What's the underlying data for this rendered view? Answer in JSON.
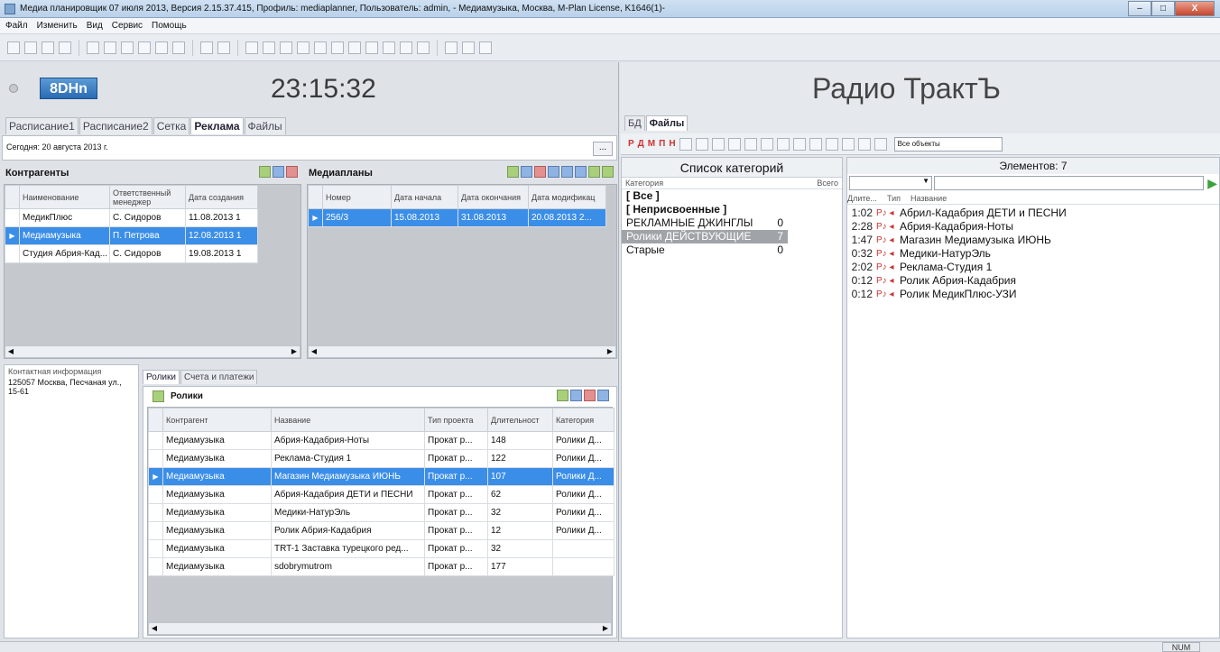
{
  "window": {
    "title": "Медиа планировщик 07 июля 2013, Версия 2.15.37.415, Профиль: mediaplanner, Пользователь: admin, - Медиамузыка, Москва, M-Plan License, K1646(1)-",
    "min": "–",
    "max": "□",
    "close": "X"
  },
  "menu": [
    "Файл",
    "Изменить",
    "Вид",
    "Сервис",
    "Помощь"
  ],
  "clock": "23:15:32",
  "logo": "8DHn",
  "radio_title": "Радио ТрактЪ",
  "left_tabs": [
    "Расписание1",
    "Расписание2",
    "Сетка",
    "Реклама",
    "Файлы"
  ],
  "today": "Сегодня: 20 августа 2013 г.",
  "dots_btn": "...",
  "contractors": {
    "title": "Контрагенты",
    "headers": [
      "Наименование",
      "Ответственный менеджер",
      "Дата создания"
    ],
    "rows": [
      [
        "МедикПлюс",
        "С. Сидоров",
        "11.08.2013 1"
      ],
      [
        "Медиамузыка",
        "П. Петрова",
        "12.08.2013 1"
      ],
      [
        "Студия Абрия-Кад...",
        "С. Сидоров",
        "19.08.2013 1"
      ]
    ]
  },
  "mediaplans": {
    "title": "Медиапланы",
    "headers": [
      "Номер",
      "Дата начала",
      "Дата окончания",
      "Дата модификац"
    ],
    "rows": [
      [
        "256/3",
        "15.08.2013",
        "31.08.2013",
        "20.08.2013 2..."
      ]
    ]
  },
  "contact": {
    "title": "Контактная информация",
    "text": "125057 Москва, Песчаная ул., 15-61"
  },
  "bottom_tabs": [
    "Ролики",
    "Счета и платежи"
  ],
  "clips": {
    "title": "Ролики",
    "headers": [
      "Контрагент",
      "Название",
      "Тип проекта",
      "Длительност",
      "Категория"
    ],
    "rows": [
      [
        "Медиамузыка",
        "Абрия-Кадабрия-Ноты",
        "Прокат р...",
        "148",
        "Ролики Д..."
      ],
      [
        "Медиамузыка",
        "Реклама-Студия 1",
        "Прокат р...",
        "122",
        "Ролики Д..."
      ],
      [
        "Медиамузыка",
        "Магазин Медиамузыка ИЮНЬ",
        "Прокат р...",
        "107",
        "Ролики Д..."
      ],
      [
        "Медиамузыка",
        "Абрия-Кадабрия ДЕТИ и ПЕСНИ",
        "Прокат р...",
        "62",
        "Ролики Д..."
      ],
      [
        "Медиамузыка",
        "Медики-НатурЭль",
        "Прокат р...",
        "32",
        "Ролики Д..."
      ],
      [
        "Медиамузыка",
        "Ролик Абрия-Кадабрия",
        "Прокат р...",
        "12",
        "Ролики Д..."
      ],
      [
        "Медиамузыка",
        "TRT-1 Заставка турецкого ред...",
        "Прокат р...",
        "32",
        ""
      ],
      [
        "Медиамузыка",
        "sdobrymutrom",
        "Прокат р...",
        "177",
        ""
      ]
    ]
  },
  "right_tabs": [
    "БД",
    "Файлы"
  ],
  "filter_select": "Все объекты",
  "categories": {
    "title": "Список категорий",
    "col1": "Категория",
    "col2": "Всего",
    "rows": [
      [
        "[ Все ]",
        ""
      ],
      [
        "[ Неприсвоенные ]",
        ""
      ],
      [
        "РЕКЛАМНЫЕ ДЖИНГЛЫ",
        "0"
      ],
      [
        "Ролики ДЕЙСТВУЮЩИЕ",
        "7"
      ],
      [
        "Старые",
        "0"
      ]
    ]
  },
  "elements": {
    "title": "Элементов: 7",
    "h_dur": "Длите...",
    "h_type": "Тип",
    "h_name": "Название",
    "rows": [
      [
        "1:02",
        "Абрил-Кадабрия ДЕТИ и ПЕСНИ"
      ],
      [
        "2:28",
        "Абрия-Кадабрия-Ноты"
      ],
      [
        "1:47",
        "Магазин Медиамузыка ИЮНЬ"
      ],
      [
        "0:32",
        "Медики-НатурЭль"
      ],
      [
        "2:02",
        "Реклама-Студия 1"
      ],
      [
        "0:12",
        "Ролик Абрия-Кадабрия"
      ],
      [
        "0:12",
        "Ролик МедикПлюс-УЗИ"
      ]
    ]
  },
  "type_icon": "Р♪ ◂",
  "status": {
    "num": "NUM"
  }
}
